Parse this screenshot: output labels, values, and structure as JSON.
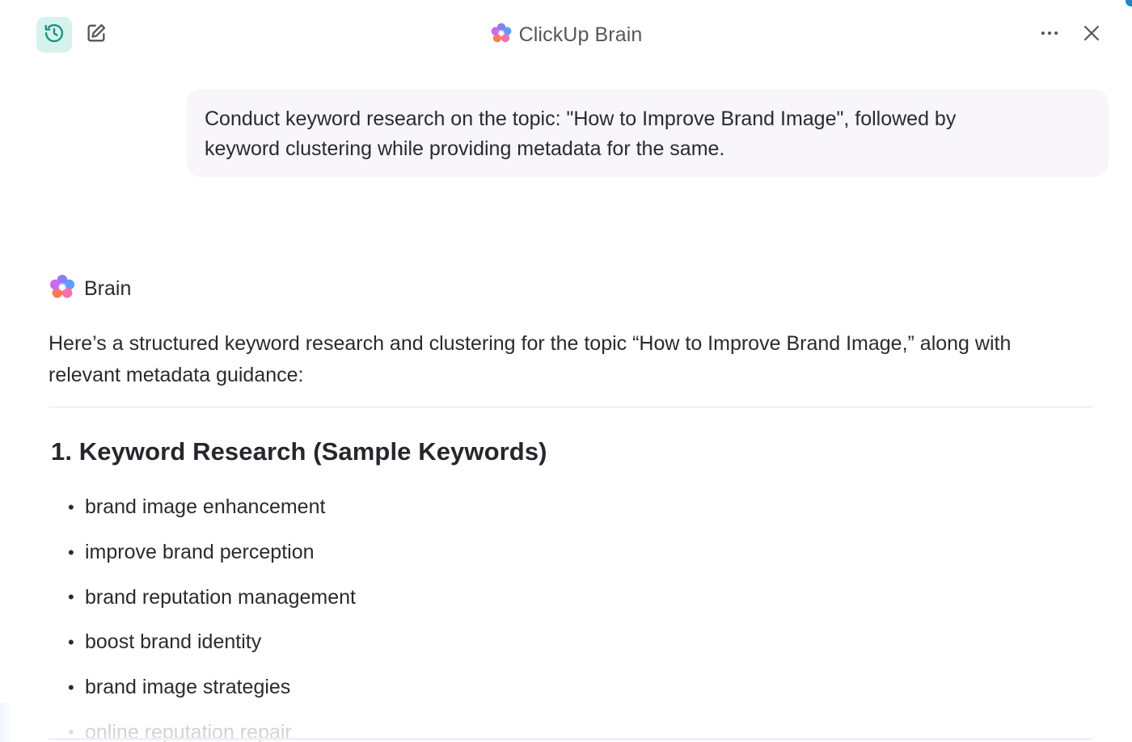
{
  "header": {
    "title": "ClickUp Brain",
    "icons": {
      "history": "history-icon",
      "compose": "new-chat-icon",
      "more": "more-horizontal-icon",
      "close": "close-icon",
      "logo": "clickup-brain-logo-icon"
    },
    "accent_color": "#1a8f7a",
    "history_bg": "#d5f3ec"
  },
  "conversation": {
    "user_message": {
      "line1": "Conduct keyword research on the topic: \"How to Improve Brand Image\", followed by",
      "line2": "keyword clustering while providing metadata for the same."
    },
    "assistant": {
      "name": "Brain",
      "intro_line1": "Here’s a structured keyword research and clustering for the topic “How to Improve Brand Image,” along with",
      "intro_line2": "relevant metadata guidance:",
      "section_heading": "1. Keyword Research (Sample Keywords)",
      "keywords": [
        "brand image enhancement",
        "improve brand perception",
        "brand reputation management",
        "boost brand identity",
        "brand image strategies",
        "online reputation repair"
      ],
      "bullet": "•"
    }
  }
}
